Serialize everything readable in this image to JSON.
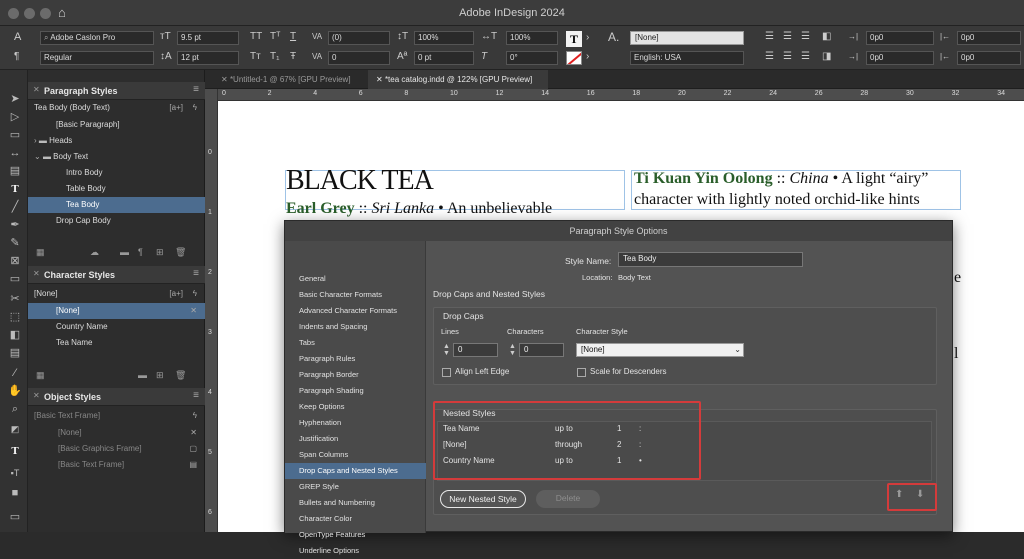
{
  "window": {
    "title": "Adobe InDesign 2024"
  },
  "control_bar": {
    "font_family": "Adobe Caslon Pro",
    "font_style": "Regular",
    "font_size": "9.5 pt",
    "leading": "12 pt",
    "kerning": "(0)",
    "tracking": "0",
    "vertical_scale": "100%",
    "horizontal_scale": "100%",
    "baseline_shift": "0 pt",
    "skew": "0°",
    "char_style": "[None]",
    "language": "English: USA",
    "indent_left": "0p0",
    "indent_first": "0p0",
    "indent_right": "0p0",
    "indent_last": "0p0",
    "tt1": "TT",
    "tt2": "Tᵀ",
    "tt3": "T",
    "tt4": "Tт",
    "tt5": "T₁",
    "tt6": "Ŧ"
  },
  "tabs": [
    {
      "label": "*Untitled-1 @ 67% [GPU Preview]"
    },
    {
      "label": "*tea catalog.indd @ 122% [GPU Preview]"
    }
  ],
  "ruler": {
    "top": [
      "0",
      "2",
      "4",
      "6",
      "8",
      "10",
      "12",
      "14",
      "16",
      "18",
      "20",
      "22",
      "24",
      "26",
      "28",
      "30",
      "32",
      "34"
    ],
    "left": [
      "0",
      "1",
      "2",
      "3",
      "4",
      "5",
      "6"
    ]
  },
  "paragraph_styles": {
    "title": "Paragraph Styles",
    "current": "Tea Body (Body Text)",
    "current_badge": "[a+]",
    "items": [
      {
        "label": "[Basic Paragraph]"
      },
      {
        "label": "Heads"
      },
      {
        "label": "Body Text"
      },
      {
        "label": "Intro Body"
      },
      {
        "label": "Table Body"
      },
      {
        "label": "Tea Body"
      },
      {
        "label": "Drop Cap Body"
      }
    ]
  },
  "character_styles": {
    "title": "Character Styles",
    "current": "[None]",
    "current_badge": "[a+]",
    "items": [
      {
        "label": "[None]"
      },
      {
        "label": "Country Name"
      },
      {
        "label": "Tea Name"
      }
    ]
  },
  "object_styles": {
    "title": "Object Styles",
    "current": "[Basic Text Frame]",
    "items": [
      {
        "label": "[None]"
      },
      {
        "label": "[Basic Graphics Frame]"
      },
      {
        "label": "[Basic Text Frame]"
      }
    ]
  },
  "document": {
    "heading": "BLACK TEA",
    "left_line_tea": "Earl Grey",
    "left_line_sep": " :: ",
    "left_line_country": "Sri Lanka",
    "left_line_rest": " • An unbelievable",
    "right_line1_tea": "Ti Kuan Yin Oolong",
    "right_line1_sep": " :: ",
    "right_line1_country": "China",
    "right_line1_rest": " • A light “airy”",
    "right_line2": "character with lightly noted orchid-like hints",
    "right_fragment_e": "e",
    "right_fragment_h": "l"
  },
  "dialog": {
    "title": "Paragraph Style Options",
    "categories": [
      "General",
      "Basic Character Formats",
      "Advanced Character Formats",
      "Indents and Spacing",
      "Tabs",
      "Paragraph Rules",
      "Paragraph Border",
      "Paragraph Shading",
      "Keep Options",
      "Hyphenation",
      "Justification",
      "Span Columns",
      "Drop Caps and Nested Styles",
      "GREP Style",
      "Bullets and Numbering",
      "Character Color",
      "OpenType Features",
      "Underline Options"
    ],
    "style_name_label": "Style Name:",
    "style_name_value": "Tea Body",
    "location_label": "Location:",
    "location_value": "Body Text",
    "section_title": "Drop Caps and Nested Styles",
    "drop_caps": {
      "title": "Drop Caps",
      "lines_label": "Lines",
      "lines_value": "0",
      "characters_label": "Characters",
      "characters_value": "0",
      "char_style_label": "Character Style",
      "char_style_value": "[None]",
      "align_left_edge": "Align Left Edge",
      "scale_for_descenders": "Scale for Descenders"
    },
    "nested_styles": {
      "title": "Nested Styles",
      "rows": [
        {
          "style": "Tea Name",
          "op": "up to",
          "count": "1",
          "delim": ":"
        },
        {
          "style": "[None]",
          "op": "through",
          "count": "2",
          "delim": ":"
        },
        {
          "style": "Country Name",
          "op": "up to",
          "count": "1",
          "delim": "•"
        }
      ]
    },
    "new_nested_style": "New Nested Style",
    "delete": "Delete"
  }
}
